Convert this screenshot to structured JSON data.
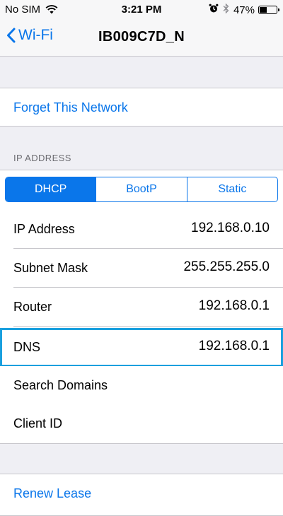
{
  "status_bar": {
    "carrier": "No SIM",
    "time": "3:21 PM",
    "battery_percent": "47%",
    "battery_level": 0.47
  },
  "nav": {
    "back_label": "Wi-Fi",
    "title": "IB009C7D_N"
  },
  "actions": {
    "forget": "Forget This Network",
    "renew": "Renew Lease"
  },
  "ip_section": {
    "header": "IP ADDRESS",
    "segments": [
      "DHCP",
      "BootP",
      "Static"
    ],
    "selected_segment": "DHCP",
    "rows": [
      {
        "label": "IP Address",
        "value": "192.168.0.10"
      },
      {
        "label": "Subnet Mask",
        "value": "255.255.255.0"
      },
      {
        "label": "Router",
        "value": "192.168.0.1"
      },
      {
        "label": "DNS",
        "value": "192.168.0.1"
      },
      {
        "label": "Search Domains",
        "value": ""
      },
      {
        "label": "Client ID",
        "value": ""
      }
    ]
  },
  "colors": {
    "accent": "#0a76ea",
    "highlight_border": "#1aa0de",
    "background": "#efeff4"
  }
}
